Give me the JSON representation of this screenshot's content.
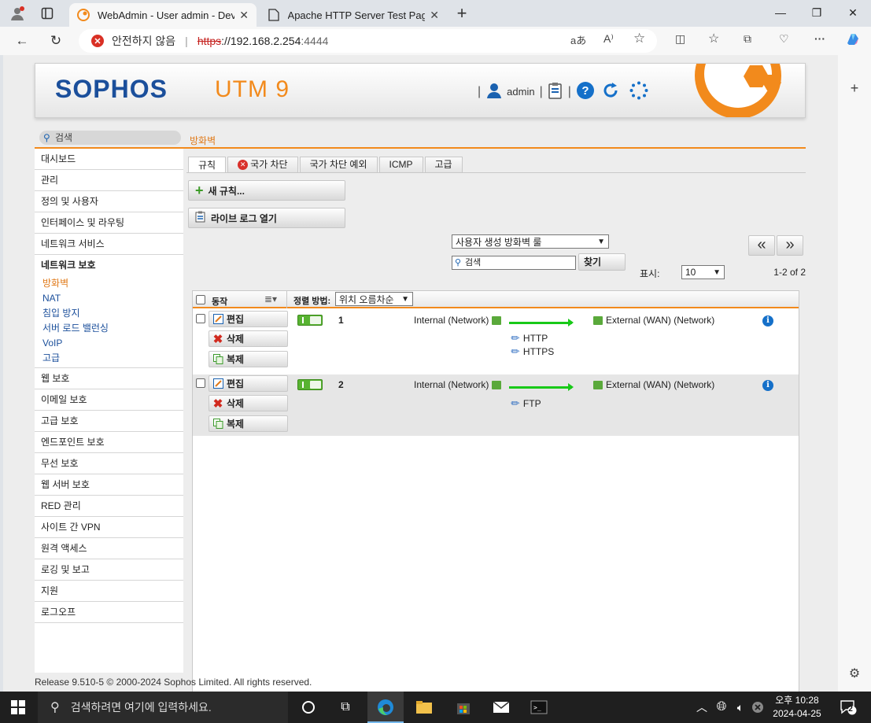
{
  "browser": {
    "tabs": [
      {
        "title": "WebAdmin - User admin - Device"
      },
      {
        "title": "Apache HTTP Server Test Page po"
      }
    ],
    "security_label": "안전하지 않음",
    "url_scheme": "https",
    "url_host": "://192.168.2.254",
    "url_port": ":4444"
  },
  "header": {
    "logo": "SOPHOS",
    "product": "UTM 9",
    "user": "admin"
  },
  "search": {
    "placeholder": "검색"
  },
  "breadcrumb": "방화벽",
  "sidebar": {
    "items_top": [
      "대시보드",
      "관리",
      "정의 및 사용자",
      "인터페이스 및 라우팅",
      "네트워크 서비스"
    ],
    "open_item": "네트워크 보호",
    "subitems": [
      "방화벽",
      "NAT",
      "침입 방지",
      "서버 로드 밸런싱",
      "VoIP",
      "고급"
    ],
    "items_bottom": [
      "웹 보호",
      "이메일 보호",
      "고급 보호",
      "엔드포인트 보호",
      "무선 보호",
      "웹 서버 보호",
      "RED 관리",
      "사이트 간 VPN",
      "원격 액세스",
      "로깅 및 보고",
      "지원",
      "로그오프"
    ]
  },
  "tabs": [
    "규칙",
    "국가 차단",
    "국가 차단 예외",
    "ICMP",
    "고급"
  ],
  "toolbar": {
    "new_rule": "새 규칙...",
    "live_log": "라이브 로그 열기",
    "filter_select": "사용자 생성 방화벽 룰",
    "filter_search": "검색",
    "find": "찾기",
    "show_label": "표시:",
    "show_value": "10",
    "range": "1-2 of 2",
    "prev": "«",
    "next": "»"
  },
  "table": {
    "col_action": "동작",
    "sort_label": "정렬 방법:",
    "sort_value": "위치 오름차순",
    "btn_edit": "편집",
    "btn_delete": "삭제",
    "btn_copy": "복제",
    "rows": [
      {
        "num": "1",
        "source": "Internal (Network)",
        "destination": "External (WAN) (Network)",
        "services": [
          "HTTP",
          "HTTPS"
        ]
      },
      {
        "num": "2",
        "source": "Internal (Network)",
        "destination": "External (WAN) (Network)",
        "services": [
          "FTP"
        ]
      }
    ]
  },
  "footer": "Release 9.510-5  © 2000-2024 Sophos Limited. All rights reserved.",
  "taskbar": {
    "search_placeholder": "검색하려면 여기에 입력하세요.",
    "time": "오후 10:28",
    "date": "2024-04-25",
    "notifications": "2"
  }
}
